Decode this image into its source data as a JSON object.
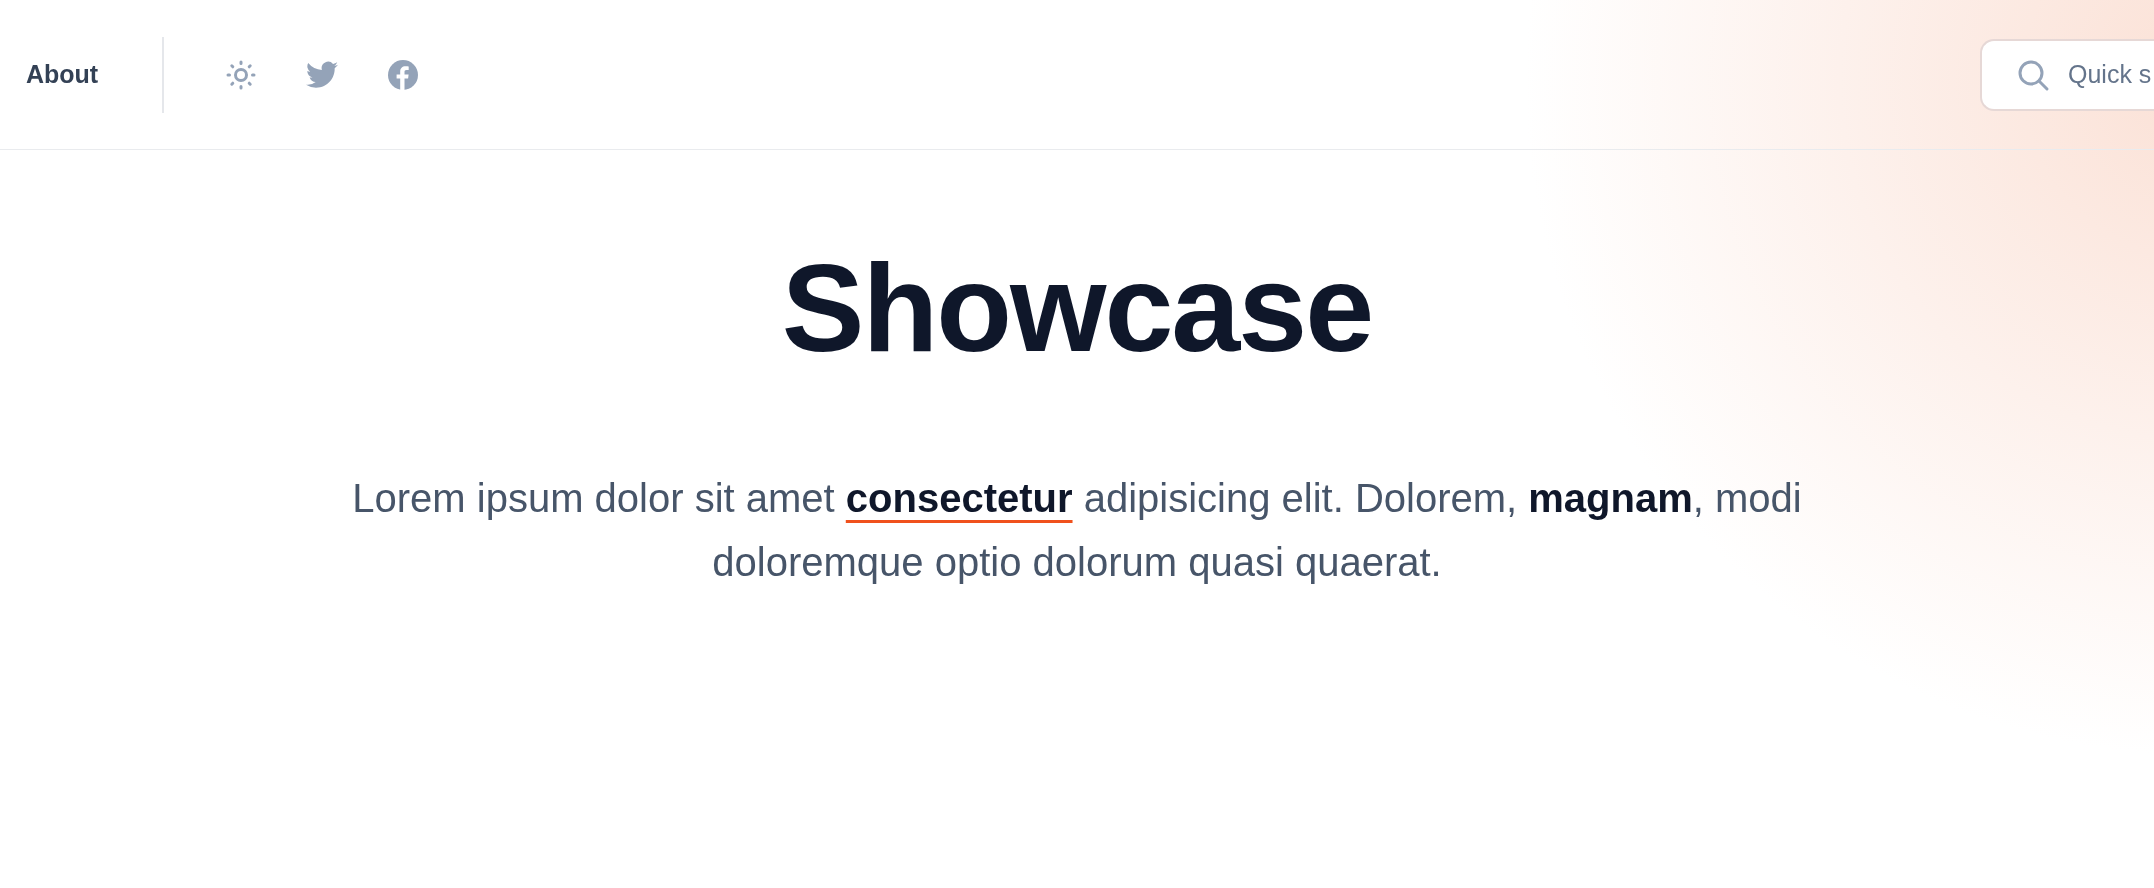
{
  "nav": {
    "about": "About"
  },
  "search": {
    "placeholder": "Quick s"
  },
  "hero": {
    "title": "Showcase",
    "text_before": "Lorem ipsum dolor sit amet",
    "link": "consectetur",
    "text_after": "adipisicing elit. Dolorem, **magnam**, modi doloremque optio dolorum quasi quaerat."
  }
}
